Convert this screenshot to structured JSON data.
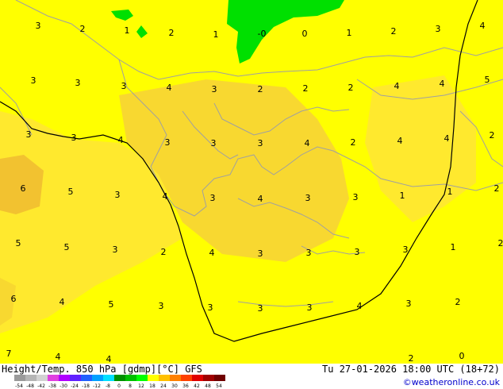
{
  "map": {
    "colors": {
      "yellow": "#ffff00",
      "gold_light": "#ffe92e",
      "gold": "#f8d830",
      "orange": "#f2c230",
      "green": "#00e000",
      "contour": "#000000",
      "coast": "#a0a0a0"
    },
    "labels": [
      {
        "t": "3"
      },
      {
        "t": "2"
      },
      {
        "t": "1"
      },
      {
        "t": "2"
      },
      {
        "t": "1"
      },
      {
        "t": "-0"
      },
      {
        "t": "0"
      },
      {
        "t": "1"
      },
      {
        "t": "2"
      },
      {
        "t": "3"
      },
      {
        "t": "4"
      },
      {
        "t": "3"
      },
      {
        "t": "3"
      },
      {
        "t": "3"
      },
      {
        "t": "4"
      },
      {
        "t": "3"
      },
      {
        "t": "2"
      },
      {
        "t": "2"
      },
      {
        "t": "2"
      },
      {
        "t": "4"
      },
      {
        "t": "4"
      },
      {
        "t": "5"
      },
      {
        "t": "3"
      },
      {
        "t": "3"
      },
      {
        "t": "4"
      },
      {
        "t": "3"
      },
      {
        "t": "3"
      },
      {
        "t": "3"
      },
      {
        "t": "4"
      },
      {
        "t": "2"
      },
      {
        "t": "4"
      },
      {
        "t": "4"
      },
      {
        "t": "2"
      },
      {
        "t": "6"
      },
      {
        "t": "5"
      },
      {
        "t": "3"
      },
      {
        "t": "4"
      },
      {
        "t": "3"
      },
      {
        "t": "4"
      },
      {
        "t": "3"
      },
      {
        "t": "3"
      },
      {
        "t": "1"
      },
      {
        "t": "1"
      },
      {
        "t": "2"
      },
      {
        "t": "5"
      },
      {
        "t": "5"
      },
      {
        "t": "3"
      },
      {
        "t": "2"
      },
      {
        "t": "4"
      },
      {
        "t": "3"
      },
      {
        "t": "3"
      },
      {
        "t": "3"
      },
      {
        "t": "3"
      },
      {
        "t": "1"
      },
      {
        "t": "2"
      },
      {
        "t": "6"
      },
      {
        "t": "4"
      },
      {
        "t": "5"
      },
      {
        "t": "3"
      },
      {
        "t": "3"
      },
      {
        "t": "3"
      },
      {
        "t": "3"
      },
      {
        "t": "4"
      },
      {
        "t": "3"
      },
      {
        "t": "2"
      },
      {
        "t": "7"
      },
      {
        "t": "4"
      },
      {
        "t": "4"
      },
      {
        "t": "2"
      },
      {
        "t": "0"
      }
    ]
  },
  "footer": {
    "title": "Height/Temp. 850 hPa [gdmp][°C] GFS",
    "datetime": "Tu 27-01-2026 18:00 UTC (18+72)",
    "credit": "©weatheronline.co.uk"
  },
  "scale": {
    "ticks": [
      "-54",
      "-48",
      "-42",
      "-38",
      "-30",
      "-24",
      "-18",
      "-12",
      "-8",
      "0",
      "8",
      "12",
      "18",
      "24",
      "30",
      "36",
      "42",
      "48",
      "54"
    ],
    "colors": [
      "#9a9a9a",
      "#b5b5b5",
      "#d2d2d2",
      "#e040e0",
      "#b000ff",
      "#6020ff",
      "#2060ff",
      "#00a0ff",
      "#00e0ff",
      "#009000",
      "#00c000",
      "#00ff00",
      "#ffff00",
      "#ffc000",
      "#ff8000",
      "#ff4000",
      "#e00000",
      "#a00000",
      "#700000"
    ]
  }
}
